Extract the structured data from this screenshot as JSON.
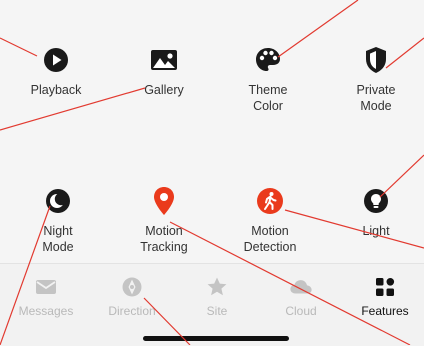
{
  "features": [
    {
      "label": "Playback",
      "icon": "play-circle-icon",
      "color": "#1a1a1a"
    },
    {
      "label": "Gallery",
      "icon": "image-icon",
      "color": "#1a1a1a"
    },
    {
      "label": "Theme\nColor",
      "icon": "palette-icon",
      "color": "#1a1a1a"
    },
    {
      "label": "Private\nMode",
      "icon": "shield-icon",
      "color": "#1a1a1a"
    },
    {
      "label": "Night\nMode",
      "icon": "moon-icon",
      "color": "#1a1a1a"
    },
    {
      "label": "Motion\nTracking",
      "icon": "location-pin-icon",
      "color": "#ea3a1c"
    },
    {
      "label": "Motion\nDetection",
      "icon": "walking-person-icon",
      "color": "#ea3a1c"
    },
    {
      "label": "Light",
      "icon": "lightbulb-icon",
      "color": "#1a1a1a"
    }
  ],
  "tabs": [
    {
      "label": "Messages",
      "icon": "message-icon",
      "active": false
    },
    {
      "label": "Direction",
      "icon": "direction-icon",
      "active": false
    },
    {
      "label": "Site",
      "icon": "star-icon",
      "active": false
    },
    {
      "label": "Cloud",
      "icon": "cloud-icon",
      "active": false
    },
    {
      "label": "Features",
      "icon": "grid-icon",
      "active": true
    }
  ],
  "accent_color": "#ea3a1c"
}
